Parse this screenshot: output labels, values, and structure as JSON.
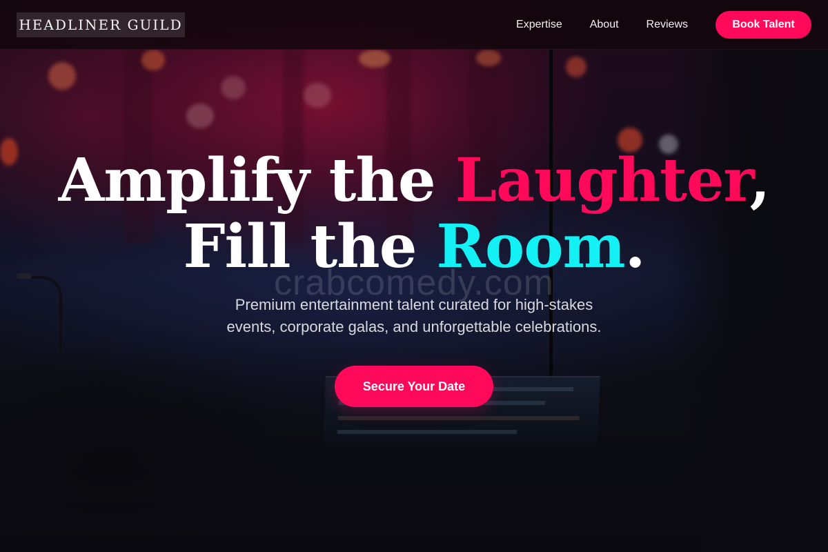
{
  "brand": {
    "name": "HEADLINER GUILD"
  },
  "nav": {
    "links": [
      "Expertise",
      "About",
      "Reviews"
    ],
    "cta_label": "Book Talent"
  },
  "hero": {
    "line1_part1": "Amplify the ",
    "line1_accent": "Laughter",
    "line1_end": ",",
    "line2_part1": "Fill the ",
    "line2_accent": "Room",
    "line2_end": ".",
    "subtitle_line1": "Premium entertainment talent curated for high-stakes",
    "subtitle_line2": "events, corporate galas, and unforgettable celebrations.",
    "cta_label": "Secure Your Date"
  },
  "watermark": "crabcomedy.com",
  "colors": {
    "accent_pink": "#ff0a5a",
    "accent_cyan": "#13f1f4",
    "header_bg": "#14060c",
    "page_bg": "#0c0b10"
  }
}
